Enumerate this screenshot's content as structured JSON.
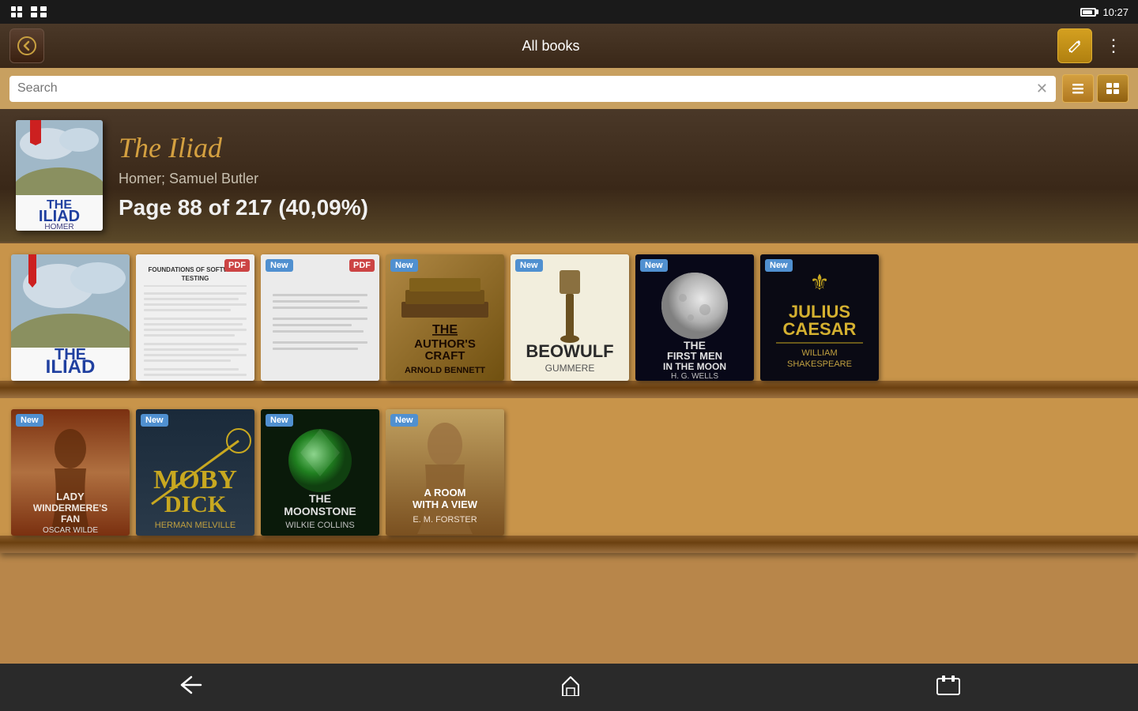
{
  "statusBar": {
    "time": "10:27",
    "icons": [
      "notification-icon",
      "grid-icon"
    ]
  },
  "topBar": {
    "title": "All books",
    "backLabel": "←",
    "editLabel": "✏",
    "menuLabel": "⋮"
  },
  "searchBar": {
    "placeholder": "Search",
    "clearBtn": "✕",
    "listViewBtn": "≡",
    "gridViewBtn": "⊞"
  },
  "currentBook": {
    "title": "The Iliad",
    "author": "Homer; Samuel Butler",
    "progress": "Page 88 of 217 (40,09%)"
  },
  "shelf1": {
    "books": [
      {
        "title": "THE ILIAD",
        "subtitle": "HOMER",
        "type": "book",
        "badge": null
      },
      {
        "title": "FOUNDATIONS OF SOFTWARE TESTING",
        "type": "pdf",
        "badge": "PDF"
      },
      {
        "title": "",
        "type": "pdf-blank",
        "badge": "New",
        "secondBadge": "PDF"
      },
      {
        "title": "THE AUTHOR'S CRAFT",
        "author": "ARNOLD BENNETT",
        "type": "book",
        "badge": "New"
      },
      {
        "title": "BEOWULF",
        "author": "GUMMERE",
        "type": "book",
        "badge": "New"
      },
      {
        "title": "THE FIRST MEN IN THE MOON",
        "author": "H. G. WELLS",
        "type": "book",
        "badge": "New"
      },
      {
        "title": "JULIUS CAESAR",
        "author": "WILLIAM SHAKESPEARE",
        "type": "book",
        "badge": "New"
      }
    ]
  },
  "shelf2": {
    "books": [
      {
        "title": "LADY WINDERMERE'S FAN",
        "author": "OSCAR WILDE",
        "type": "book",
        "badge": "New"
      },
      {
        "title": "MOBY DICK",
        "author": "HERMAN MELVILLE",
        "type": "book",
        "badge": "New"
      },
      {
        "title": "THE MOONSTONE",
        "author": "WILKIE COLLINS",
        "type": "book",
        "badge": "New"
      },
      {
        "title": "A ROOM WITH A VIEW",
        "author": "E. M. FORSTER",
        "type": "book",
        "badge": "New"
      }
    ]
  },
  "bottomNav": {
    "backBtn": "←",
    "homeBtn": "⌂",
    "recentBtn": "▭"
  }
}
